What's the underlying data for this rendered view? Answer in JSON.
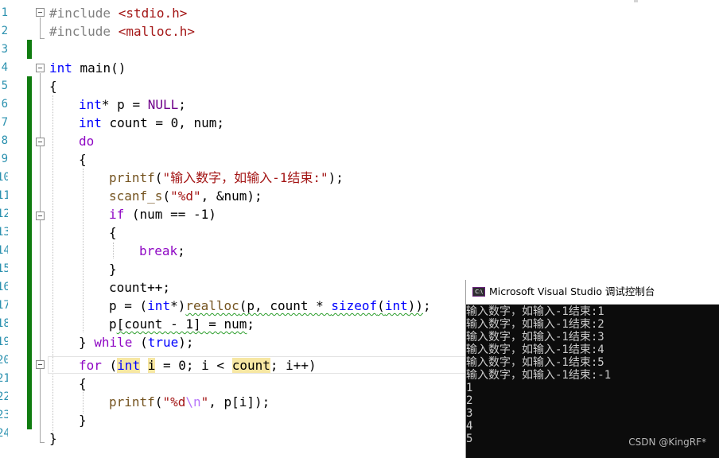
{
  "editor": {
    "line_numbers": [
      "1",
      "2",
      "3",
      "4",
      "5",
      "6",
      "7",
      "8",
      "9",
      "10",
      "11",
      "12",
      "13",
      "14",
      "15",
      "16",
      "17",
      "18",
      "19",
      "20",
      "21",
      "22",
      "23",
      "24"
    ],
    "lines": {
      "l1": {
        "pp": "#include",
        "sp": " ",
        "hdr": "<stdio.h>"
      },
      "l2": {
        "pp": "#include",
        "sp": " ",
        "hdr": "<malloc.h>"
      },
      "l4": {
        "kw": "int",
        "rest": " main()"
      },
      "l5": {
        "text": "{"
      },
      "l6": {
        "kw": "int",
        "a": "* p = ",
        "mac": "NULL",
        "b": ";"
      },
      "l7": {
        "kw": "int",
        "a": " count = 0, num;"
      },
      "l8": {
        "ctl": "do"
      },
      "l9": {
        "text": "{"
      },
      "l10": {
        "fn": "printf",
        "a": "(",
        "str": "\"输入数字，如输入-1结束:\"",
        "b": ");"
      },
      "l11": {
        "fn": "scanf_s",
        "a": "(",
        "str": "\"%d\"",
        "b": ", &num);"
      },
      "l12": {
        "ctl": "if",
        "a": " (num == -1)"
      },
      "l13": {
        "text": "{"
      },
      "l14": {
        "ctl": "break",
        "a": ";"
      },
      "l15": {
        "text": "}"
      },
      "l16": {
        "text": "count++;"
      },
      "l17": {
        "a": "p = (",
        "kw": "int",
        "b": "*)",
        "fn1": "realloc",
        "sq": "(p, count * ",
        "kw2": "sizeof",
        "c": "(",
        "kw3": "int",
        "d": "))",
        "e": ";"
      },
      "l18": {
        "a": "p",
        "sq": "[count - 1] = num",
        "b": ";"
      },
      "l19": {
        "a": "} ",
        "ctl": "while",
        "b": " (",
        "kw": "true",
        "c": ");"
      },
      "l20": {
        "ctl": "for",
        "a": " (",
        "kw": "int",
        "b": " ",
        "hl1": "i",
        "c": " = 0; i < ",
        "hl2": "count",
        "d": "; i++)"
      },
      "l21": {
        "text": "{"
      },
      "l22": {
        "fn": "printf",
        "a": "(",
        "str1": "\"%d",
        "esc": "\\n",
        "str2": "\"",
        "b": ", p[i]);"
      },
      "l23": {
        "text": "}"
      },
      "l24": {
        "text": "}"
      }
    }
  },
  "console": {
    "icon_text": "C:\\",
    "title": "Microsoft Visual Studio 调试控制台",
    "output": [
      "输入数字，如输入-1结束:1",
      "输入数字，如输入-1结束:2",
      "输入数字，如输入-1结束:3",
      "输入数字，如输入-1结束:4",
      "输入数字，如输入-1结束:5",
      "输入数字，如输入-1结束:-1",
      "1",
      "2",
      "3",
      "4",
      "5"
    ]
  },
  "watermark": "CSDN @KingRF*",
  "colors": {
    "keyword": "#0000ff",
    "preprocessor": "#808080",
    "string": "#a31515",
    "control": "#8f08c4",
    "function": "#74531f",
    "change_bar": "#107c10",
    "console_bg": "#0c0c0c"
  }
}
